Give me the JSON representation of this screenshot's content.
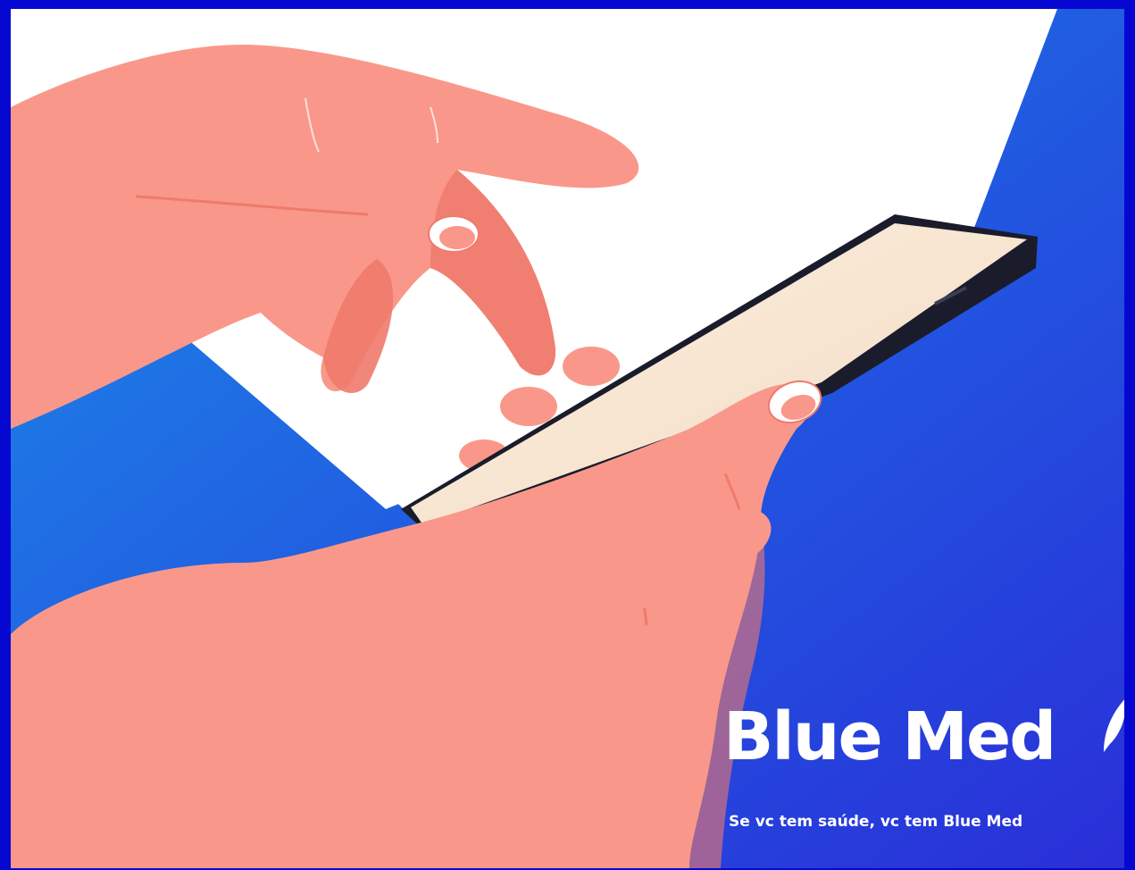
{
  "brand": {
    "name": "Blue Med",
    "tagline": "Se vc tem saúde, vc tem Blue Med"
  },
  "colors": {
    "border": "#0707d2",
    "background_light": "#1e8ae6",
    "background_dark": "#2230d8",
    "white_panel": "#ffffff",
    "skin": "#f9988a",
    "skin_shadow": "#f07a6c",
    "phone_body": "#1a1c2c",
    "phone_screen": "#f6e5d2",
    "text": "#ffffff"
  },
  "icons": {
    "leaf": "leaf-icon"
  }
}
